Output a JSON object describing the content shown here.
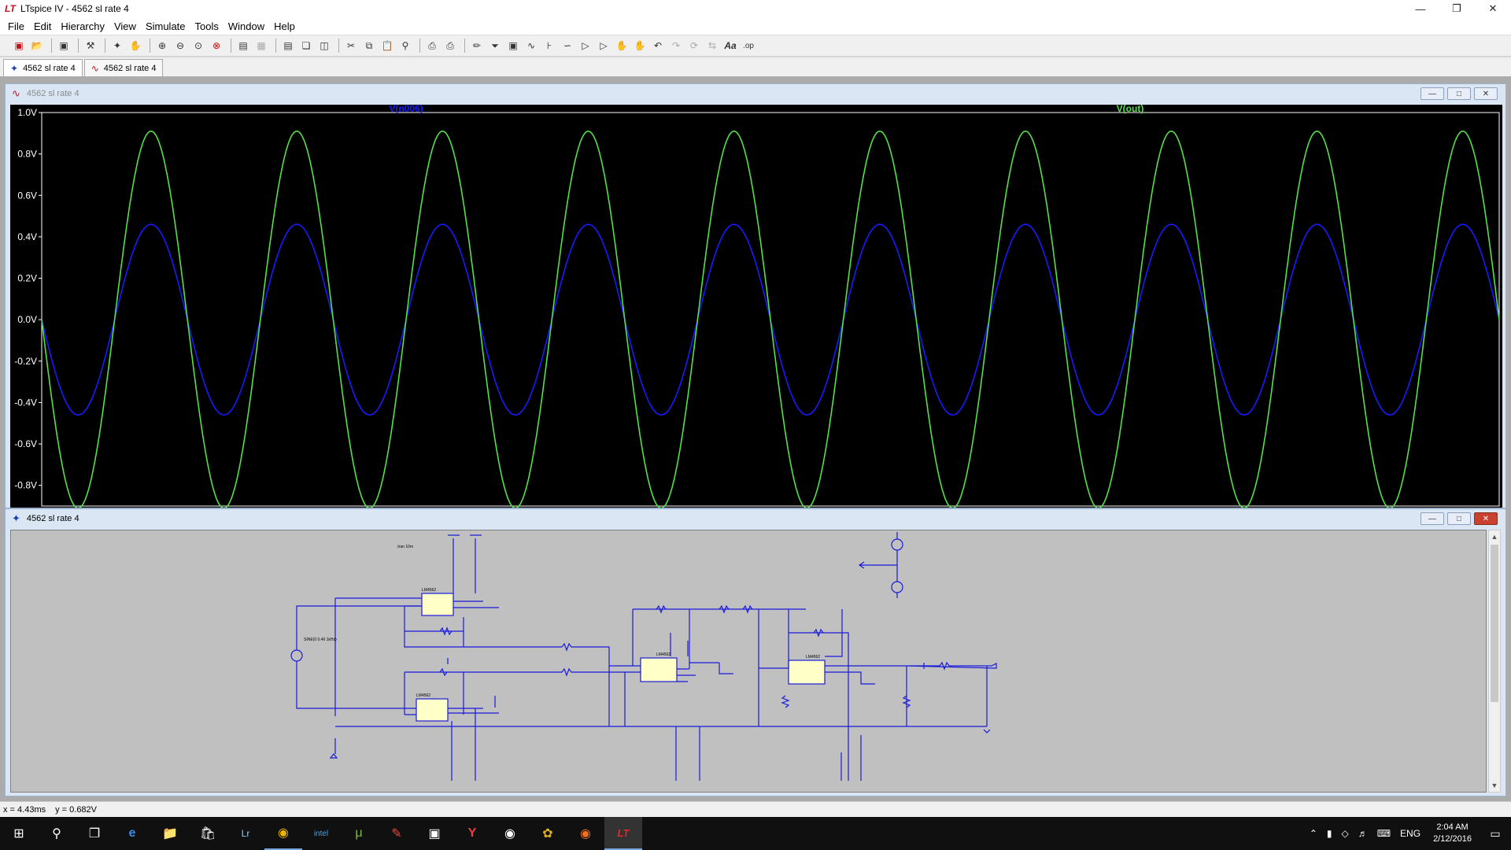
{
  "window": {
    "title": "LTspice IV - 4562  sl rate 4",
    "app_icon": "ltspice-logo-icon"
  },
  "menu": [
    "File",
    "Edit",
    "Hierarchy",
    "View",
    "Simulate",
    "Tools",
    "Window",
    "Help"
  ],
  "toolbar_icons": [
    "new-schematic-icon",
    "open-icon",
    "save-icon",
    "control-panel-icon",
    "run-icon",
    "halt-icon",
    "zoom-in-icon",
    "zoom-out-icon",
    "zoom-fit-icon",
    "zoom-cancel-icon",
    "autorange-icon",
    "grid-icon",
    "tile-horizontal-icon",
    "cascade-icon",
    "tile-vertical-icon",
    "cut-icon",
    "copy-icon",
    "paste-icon",
    "find-icon",
    "print-icon",
    "print-setup-icon",
    "wire-icon",
    "ground-icon",
    "label-icon",
    "resistor-icon",
    "capacitor-icon",
    "inductor-icon",
    "diode-icon",
    "component-icon",
    "move-icon",
    "drag-icon",
    "undo-icon",
    "redo-icon",
    "rotate-icon",
    "mirror-icon",
    "text-icon",
    "spice-directive-icon"
  ],
  "doc_tabs": [
    {
      "label": "4562  sl rate 4",
      "icon": "schematic-icon"
    },
    {
      "label": "4562  sl rate 4",
      "icon": "waveform-icon"
    }
  ],
  "waveform": {
    "window_title": "4562  sl rate 4",
    "traces": [
      {
        "name": "V(n006)",
        "color": "#1a1aff"
      },
      {
        "name": "V(out)",
        "color": "#55e04a"
      }
    ]
  },
  "chart_data": {
    "type": "line",
    "title": "",
    "xlabel": "",
    "ylabel": "",
    "ylim": [
      -0.9,
      1.0
    ],
    "yticks": [
      "1.0V",
      "0.8V",
      "0.6V",
      "0.4V",
      "0.2V",
      "0.0V",
      "-0.2V",
      "-0.4V",
      "-0.6V",
      "-0.8V"
    ],
    "grid": false,
    "cycles_visible": 10,
    "series": [
      {
        "name": "V(n006)",
        "amplitude": 0.46,
        "phase": "negative-sine"
      },
      {
        "name": "V(out)",
        "amplitude": 0.91,
        "phase": "negative-sine"
      }
    ]
  },
  "schematic": {
    "window_title": "4562  sl rate 4",
    "directive": ".tran 10m",
    "source_label": "SINE(0 0.46 1kHz)",
    "opamp_type": "LM4562"
  },
  "status": {
    "x": "x = 4.43ms",
    "y": "y = 0.682V"
  },
  "taskbar": {
    "apps": [
      "windows-start-icon",
      "search-icon",
      "task-view-icon",
      "edge-icon",
      "file-explorer-icon",
      "store-icon",
      "lightroom-icon",
      "chrome-icon",
      "intel-icon",
      "utorrent-icon",
      "paint-icon",
      "app-icon",
      "yandex-icon",
      "camera-icon",
      "palette-icon",
      "firefox-icon",
      "ltspice-icon"
    ],
    "language": "ENG",
    "time": "2:04 AM",
    "date": "2/12/2016"
  }
}
